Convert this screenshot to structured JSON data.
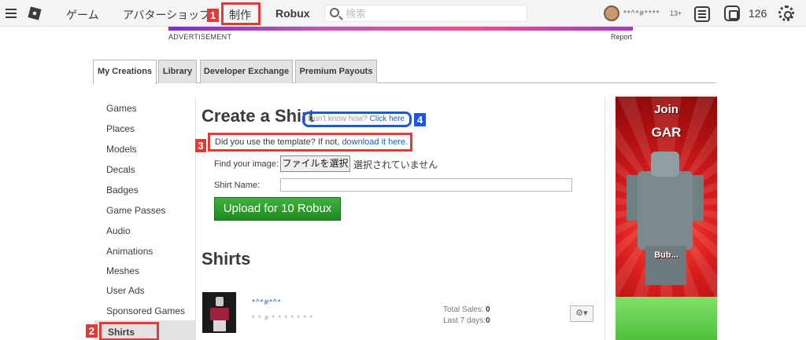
{
  "nav": {
    "game": "ゲーム",
    "avatar_shop": "アバターショップ",
    "create": "制作",
    "robux": "Robux",
    "search_placeholder": "検索",
    "username": "**^*#****",
    "age": "13+",
    "robux_balance": "126"
  },
  "ad": {
    "label": "ADVERTISEMENT",
    "report": "Report",
    "side_title_1": "Join",
    "side_title_2": "GAR",
    "side_bottom": "Bub..."
  },
  "tabs": [
    "My Creations",
    "Library",
    "Developer Exchange",
    "Premium Payouts"
  ],
  "sidebar": {
    "items": [
      "Games",
      "Places",
      "Models",
      "Decals",
      "Badges",
      "Game Passes",
      "Audio",
      "Animations",
      "Meshes",
      "User Ads",
      "Sponsored Games",
      "Shirts"
    ]
  },
  "create_form": {
    "heading": "Create a Shirt",
    "hint_prefix": "Don't know how? ",
    "hint_link": "Click here",
    "template_text": "Did you use the template? If not, ",
    "template_link": "download it here.",
    "image_label": "Find your image:",
    "file_button": "ファイルを選択",
    "file_status": "選択されていません",
    "name_label": "Shirt Name:",
    "upload_button": "Upload for 10 Robux"
  },
  "shirts": {
    "title": "Shirts",
    "item": {
      "name": "*^*#*^*",
      "sub": "* * # * * * * * * *",
      "total_sales_label": "Total Sales:",
      "total_sales": "0",
      "last7_label": "Last 7 days:",
      "last7": "0",
      "gear_label": "⚙▾"
    }
  },
  "annotations": {
    "badge_1": "1",
    "badge_2": "2",
    "badge_3": "3",
    "badge_4": "4",
    "red": "#e53935",
    "blue": "#1e56e0"
  }
}
